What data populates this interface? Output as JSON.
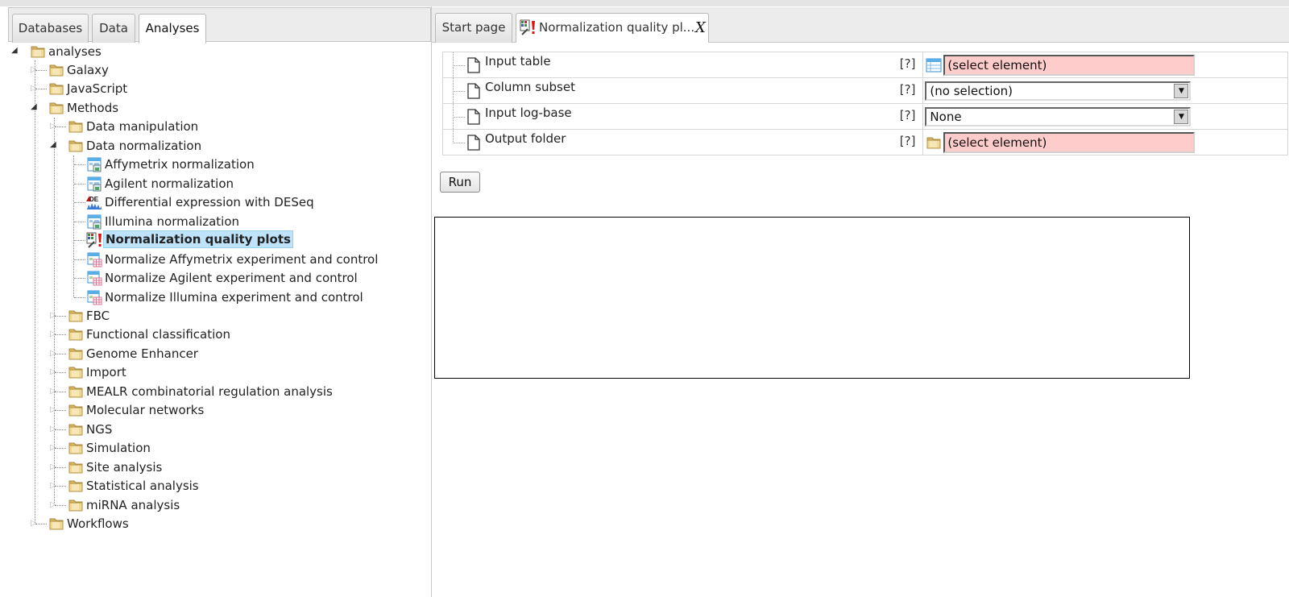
{
  "left_tabs": [
    "Databases",
    "Data",
    "Analyses"
  ],
  "left_active_tab": "Analyses",
  "tree": {
    "root": "analyses",
    "level1": {
      "galaxy": "Galaxy",
      "javascript": "JavaScript",
      "methods": "Methods",
      "workflows": "Workflows"
    },
    "methods_children": {
      "data_manipulation": "Data manipulation",
      "data_normalization": "Data normalization",
      "fbc": "FBC",
      "functional_classification": "Functional classification",
      "genome_enhancer": "Genome Enhancer",
      "import": "Import",
      "mealr": "MEALR combinatorial regulation analysis",
      "molecular_networks": "Molecular networks",
      "ngs": "NGS",
      "simulation": "Simulation",
      "site_analysis": "Site analysis",
      "statistical_analysis": "Statistical analysis",
      "mirna_analysis": "miRNA analysis"
    },
    "normalization_children": {
      "affymetrix": "Affymetrix normalization",
      "agilent": "Agilent normalization",
      "deseq": "Differential expression with DESeq",
      "illumina": "Illumina normalization",
      "quality_plots": "Normalization quality plots",
      "norm_affymetrix": "Normalize Affymetrix experiment and control",
      "norm_agilent": "Normalize Agilent experiment and control",
      "norm_illumina": "Normalize Illumina experiment and control"
    },
    "selected": "Normalization quality plots"
  },
  "right_tabs": {
    "start": "Start page",
    "current": "Normalization quality pl...",
    "close": "X"
  },
  "params": [
    {
      "name": "Input table",
      "help": "[?]",
      "value": "(select element)",
      "kind": "element",
      "icon": "table-icon"
    },
    {
      "name": "Column subset",
      "help": "[?]",
      "value": "(no selection)",
      "kind": "dropdown"
    },
    {
      "name": "Input log-base",
      "help": "[?]",
      "value": "None",
      "kind": "dropdown"
    },
    {
      "name": "Output folder",
      "help": "[?]",
      "value": "(select element)",
      "kind": "element",
      "icon": "folder-icon"
    }
  ],
  "run_label": "Run",
  "colors": {
    "selection_bg": "#bfe3fb",
    "required_field": "#ffcccc",
    "folder": "#e6c47a"
  }
}
